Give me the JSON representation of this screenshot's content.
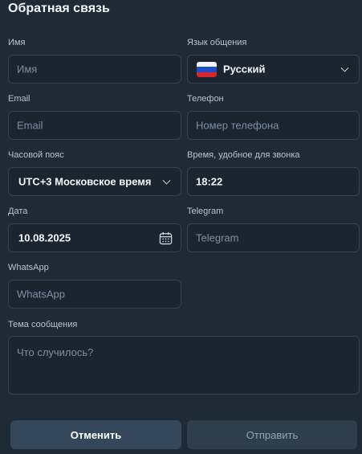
{
  "title": "Обратная связь",
  "name": {
    "label": "Имя",
    "placeholder": "Имя"
  },
  "language": {
    "label": "Язык общения",
    "value": "Русский",
    "flag": "ru-flag"
  },
  "email": {
    "label": "Email",
    "placeholder": "Email"
  },
  "phone": {
    "label": "Телефон",
    "placeholder": "Номер телефона"
  },
  "timezone": {
    "label": "Часовой пояс",
    "value": "UTC+3 Московское время"
  },
  "call_time": {
    "label": "Время, удобное для звонка",
    "value": "18:22"
  },
  "date": {
    "label": "Дата",
    "value": "10.08.2025"
  },
  "telegram": {
    "label": "Telegram",
    "placeholder": "Telegram"
  },
  "whatsapp": {
    "label": "WhatsApp",
    "placeholder": "WhatsApp"
  },
  "subject": {
    "label": "Тема сообщения",
    "placeholder": "Что случилось?"
  },
  "buttons": {
    "cancel": "Отменить",
    "send": "Отправить"
  },
  "colors": {
    "background": "#1e2a36",
    "field_bg": "#1a2530",
    "field_border": "#34434f",
    "cancel_bg": "#34475b",
    "send_bg": "#2f3e4c"
  }
}
